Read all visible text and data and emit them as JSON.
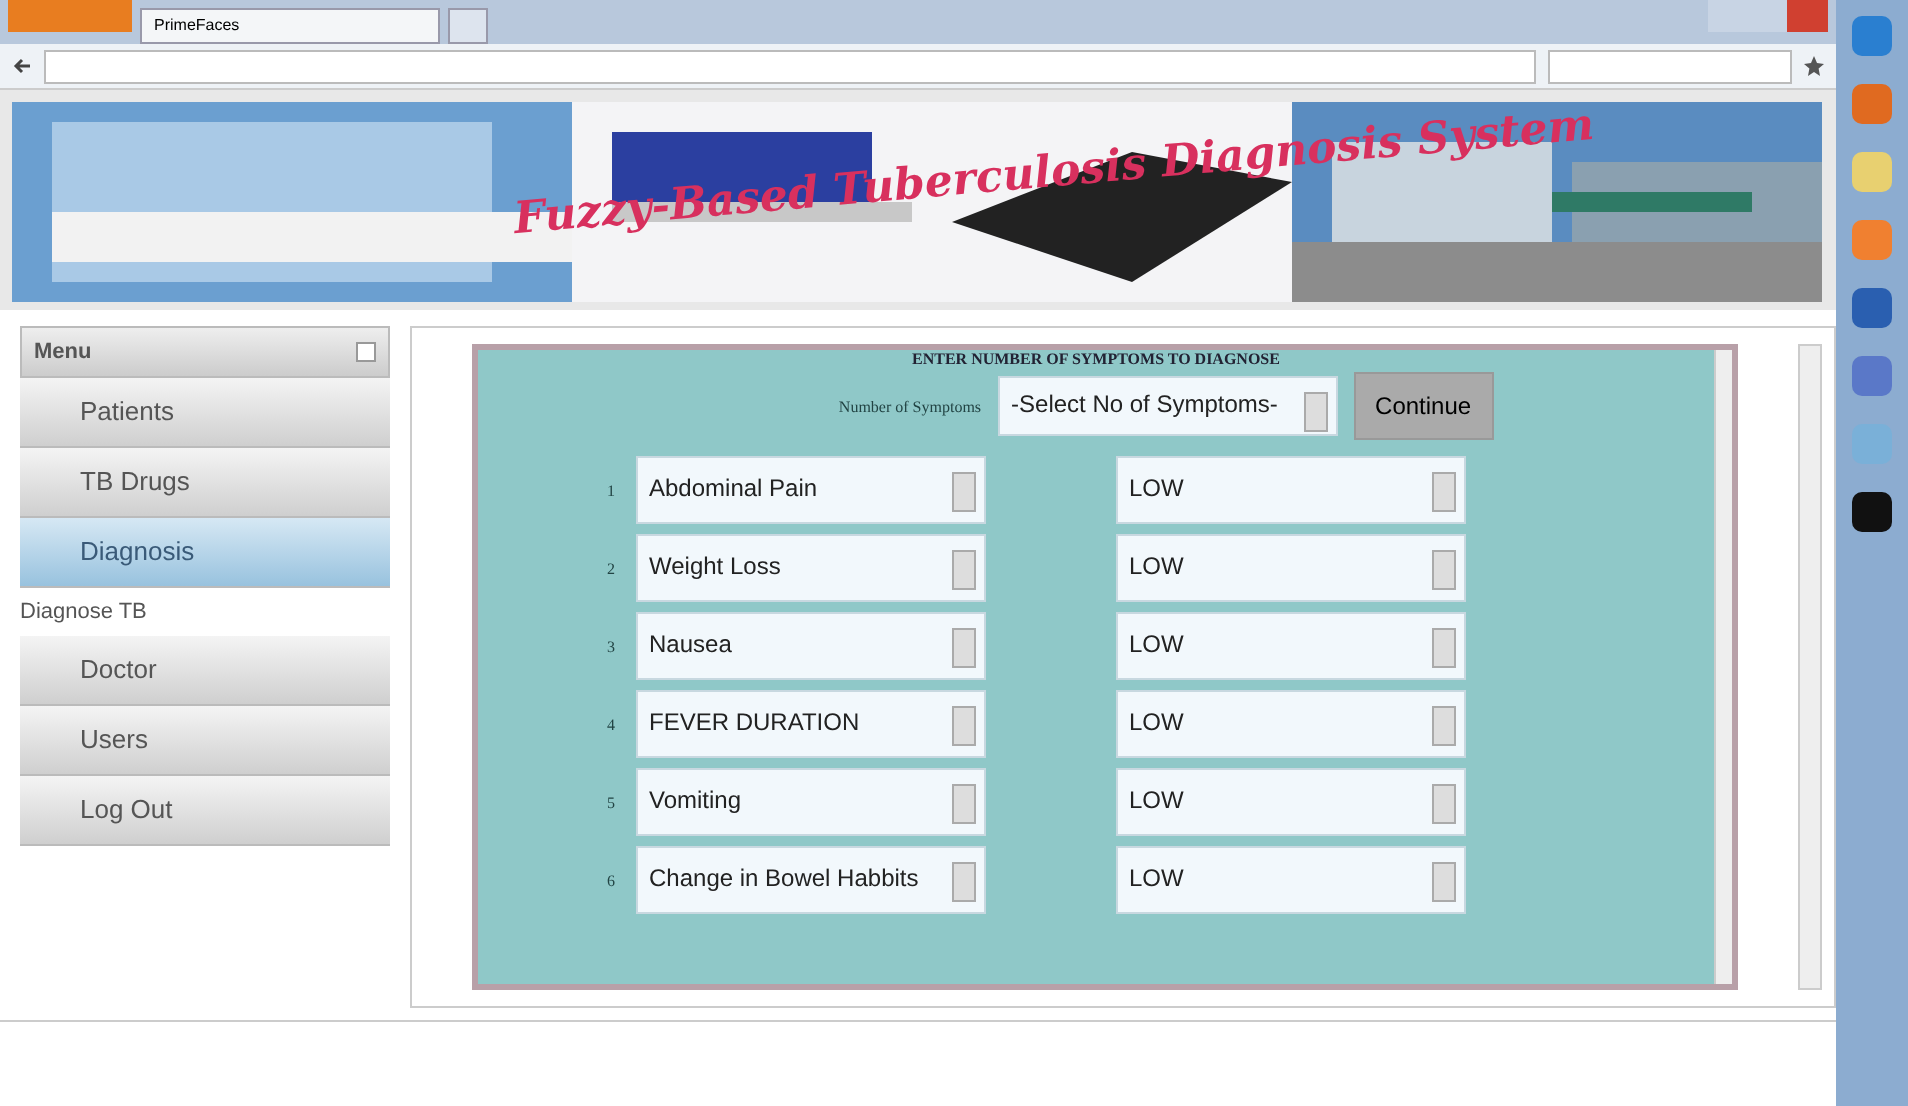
{
  "browser": {
    "tab": "PrimeFaces"
  },
  "banner": {
    "title": "Fuzzy-Based Tuberculosis Diagnosis System"
  },
  "menu": {
    "title": "Menu",
    "items": [
      {
        "label": "Patients",
        "selected": false
      },
      {
        "label": "TB Drugs",
        "selected": false
      },
      {
        "label": "Diagnosis",
        "selected": true,
        "children": [
          {
            "label": "Diagnose TB"
          }
        ]
      },
      {
        "label": "Doctor",
        "selected": false
      },
      {
        "label": "Users",
        "selected": false
      },
      {
        "label": "Log Out",
        "selected": false
      }
    ]
  },
  "form": {
    "heading": "ENTER NUMBER OF SYMPTOMS TO DIAGNOSE",
    "count_label": "Number of Symptoms",
    "count_select": "-Select No of Symptoms-",
    "button": "Continue",
    "rows": [
      {
        "number": "1",
        "symptom": "Abdominal Pain",
        "severity": "LOW"
      },
      {
        "number": "2",
        "symptom": "Weight Loss",
        "severity": "LOW"
      },
      {
        "number": "3",
        "symptom": "Nausea",
        "severity": "LOW"
      },
      {
        "number": "4",
        "symptom": "FEVER DURATION",
        "severity": "LOW"
      },
      {
        "number": "5",
        "symptom": "Vomiting",
        "severity": "LOW"
      },
      {
        "number": "6",
        "symptom": "Change in Bowel Habbits",
        "severity": "LOW"
      }
    ]
  }
}
